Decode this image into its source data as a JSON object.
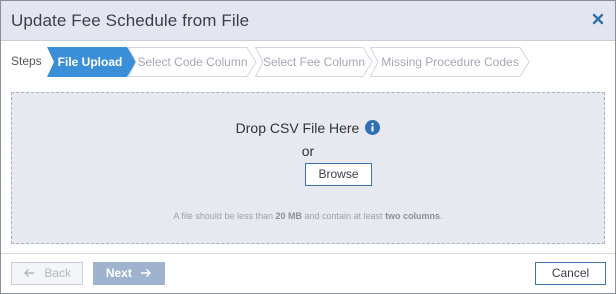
{
  "dialog": {
    "title": "Update Fee Schedule from File"
  },
  "steps": {
    "label": "Steps",
    "items": [
      {
        "label": "File Upload",
        "state": "active"
      },
      {
        "label": "Select Code Column",
        "state": "inactive"
      },
      {
        "label": "Select Fee Column",
        "state": "inactive"
      },
      {
        "label": "Missing Procedure Codes",
        "state": "inactive"
      }
    ]
  },
  "dropzone": {
    "prompt": "Drop CSV File Here",
    "or_text": "or",
    "browse_label": "Browse",
    "hint_prefix": "A file should be less than ",
    "hint_size": "20 MB",
    "hint_middle": " and contain at least ",
    "hint_columns": "two columns",
    "hint_suffix": "."
  },
  "footer": {
    "back_label": "Back",
    "next_label": "Next",
    "cancel_label": "Cancel"
  },
  "colors": {
    "accent": "#3a8fd8",
    "header_bg": "#e3e6ee",
    "step_inactive_bg": "#ffffff",
    "dropzone_bg": "#e6e9f0",
    "next_disabled_bg": "#9fb3cf"
  },
  "icons": {
    "close": "close-icon",
    "info": "info-icon",
    "back_arrow": "arrow-left-icon",
    "next_arrow": "arrow-right-icon"
  }
}
